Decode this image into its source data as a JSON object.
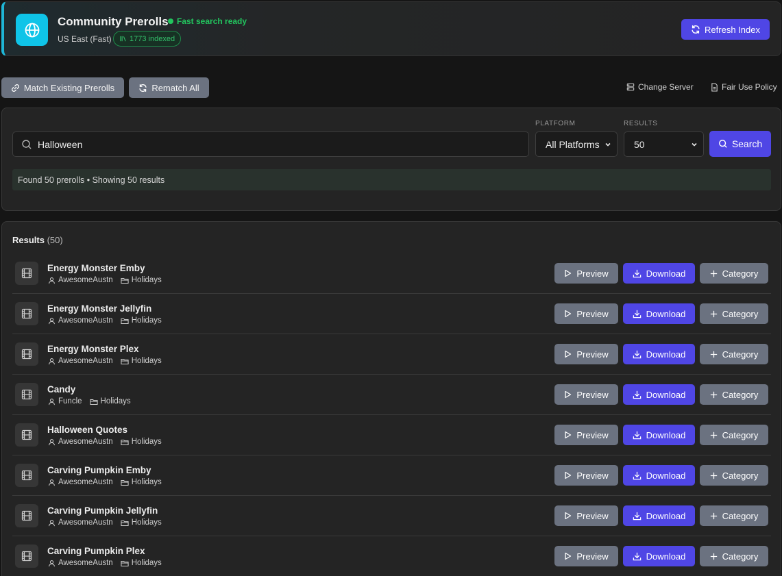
{
  "header": {
    "title": "Community Prerolls",
    "status": "Fast search ready",
    "server": "US East (Fast)",
    "indexed": "1773 indexed",
    "refresh_label": "Refresh Index",
    "logo_icon": "globe-icon",
    "accent": "#0fc4e8"
  },
  "actions": {
    "match_label": "Match Existing Prerolls",
    "rematch_label": "Rematch All",
    "change_server_label": "Change Server",
    "fair_use_label": "Fair Use Policy"
  },
  "search": {
    "query": "Halloween",
    "platform_label": "PLATFORM",
    "platform_value": "All Platforms",
    "results_label": "RESULTS",
    "results_value": "50",
    "button_label": "Search",
    "found_text": "Found 50 prerolls • Showing 50 results"
  },
  "results": {
    "title": "Results",
    "count": "(50)",
    "preview_label": "Preview",
    "download_label": "Download",
    "category_label": "Category",
    "items": [
      {
        "title": "Energy Monster Emby",
        "author": "AwesomeAustn",
        "category": "Holidays"
      },
      {
        "title": "Energy Monster Jellyfin",
        "author": "AwesomeAustn",
        "category": "Holidays"
      },
      {
        "title": "Energy Monster Plex",
        "author": "AwesomeAustn",
        "category": "Holidays"
      },
      {
        "title": "Candy",
        "author": "Funcle",
        "category": "Holidays"
      },
      {
        "title": "Halloween Quotes",
        "author": "AwesomeAustn",
        "category": "Holidays"
      },
      {
        "title": "Carving Pumpkin Emby",
        "author": "AwesomeAustn",
        "category": "Holidays"
      },
      {
        "title": "Carving Pumpkin Jellyfin",
        "author": "AwesomeAustn",
        "category": "Holidays"
      },
      {
        "title": "Carving Pumpkin Plex",
        "author": "AwesomeAustn",
        "category": "Holidays"
      }
    ]
  },
  "colors": {
    "primary": "#4f46e5",
    "secondary": "#6b7280",
    "success": "#22c55e"
  }
}
